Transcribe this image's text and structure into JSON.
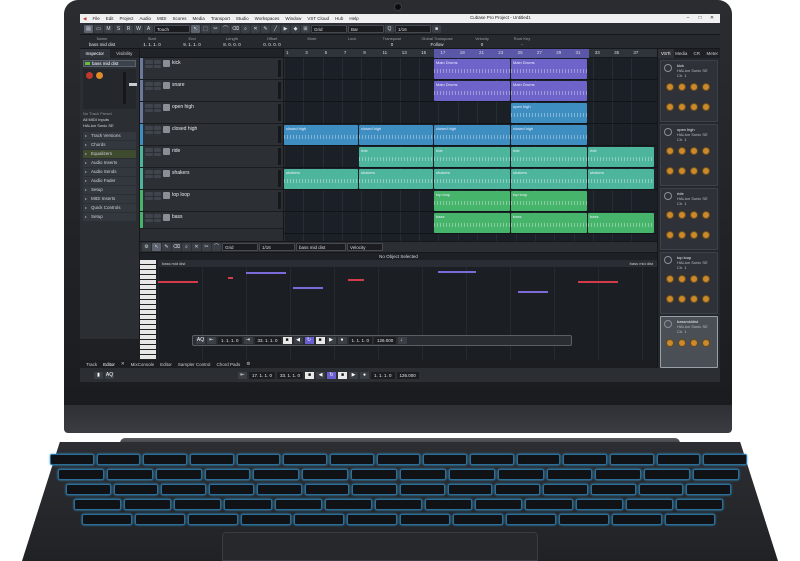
{
  "window": {
    "title": "Cubase Pro Project - Untitled1"
  },
  "menu": [
    "File",
    "Edit",
    "Project",
    "Audio",
    "MIDI",
    "Scores",
    "Media",
    "Transport",
    "Studio",
    "Workspaces",
    "Window",
    "VST Cloud",
    "Hub",
    "Help"
  ],
  "toolbar": {
    "mode": "Touch",
    "grid": "Grid",
    "bar": "Bar",
    "quantize": "1/16"
  },
  "infoline": {
    "labels": [
      "Name",
      "Start",
      "End",
      "Length",
      "Offset",
      "Mute",
      "Lock",
      "Transpose",
      "Global Transpose",
      "Velocity",
      "Root Key"
    ],
    "values": [
      "bass mid dist",
      "1. 1. 1. 0",
      "9. 1. 1. 0",
      "8. 0. 0. 0",
      "0. 0. 0. 0",
      "",
      "",
      "0",
      "Follow",
      "0",
      "-"
    ]
  },
  "inspector": {
    "tabs": [
      "Inspector",
      "Visibility"
    ],
    "track": "bass mid dist",
    "inputs": [
      "No Track Preset",
      "All MIDI Inputs",
      "HALion Sonic SE"
    ],
    "sections": [
      "Track Versions",
      "Chords",
      "Equalizers",
      "Audio Inserts",
      "Audio Sends",
      "Audio Fader",
      "Setup",
      "MIDI Inserts",
      "Quick Controls",
      "Setup"
    ]
  },
  "tracks": [
    {
      "name": "kick",
      "color": "#6b7a9c"
    },
    {
      "name": "snare",
      "color": "#6b7a9c"
    },
    {
      "name": "open high",
      "color": "#6b7a9c"
    },
    {
      "name": "closed high",
      "color": "#3e8ec2"
    },
    {
      "name": "ride",
      "color": "#4cb59b"
    },
    {
      "name": "shakers",
      "color": "#4cb59b"
    },
    {
      "name": "top loop",
      "color": "#46b46b"
    },
    {
      "name": "bass",
      "color": "#46b46b"
    }
  ],
  "ruler": [
    "1",
    "3",
    "5",
    "7",
    "9",
    "11",
    "13",
    "15",
    "17",
    "19",
    "21",
    "23",
    "25",
    "27",
    "29",
    "31",
    "33",
    "35",
    "37"
  ],
  "parts": {
    "p1": "Main Drums",
    "p2": "closed high",
    "p3": "ride",
    "p4": "shakers",
    "p5": "open high",
    "p6": "top loop",
    "p7": "bass"
  },
  "rack": {
    "tabs": [
      "VSTi",
      "Media",
      "CR",
      "Meter"
    ],
    "instruments": [
      {
        "name": "kick",
        "plugin": "HALion Sonic SE",
        "channel": "Ch. 1"
      },
      {
        "name": "open high",
        "plugin": "HALion Sonic SE",
        "channel": "Ch. 1"
      },
      {
        "name": "ride",
        "plugin": "HALion Sonic SE",
        "channel": "Ch. 1"
      },
      {
        "name": "top loop",
        "plugin": "HALion Sonic SE",
        "channel": "Ch. 1"
      },
      {
        "name": "bassmiddist",
        "plugin": "HALion Sonic SE",
        "channel": "Ch. 1"
      }
    ]
  },
  "editor": {
    "info": "No Object Selected",
    "part_name": "bass mid dist",
    "velocity": "Velocity",
    "grid": "Grid",
    "quantize": "1/16"
  },
  "transport": {
    "position": "17. 1. 1. 0",
    "left": "1. 1. 1. 0",
    "right": "33. 1. 1. 0",
    "time": "1. 1. 1. 0",
    "tempo": "126.000"
  },
  "bottom_tabs": [
    "Track",
    "Editor",
    "MixConsole",
    "Editor",
    "Sampler Control",
    "Chord Pads"
  ]
}
